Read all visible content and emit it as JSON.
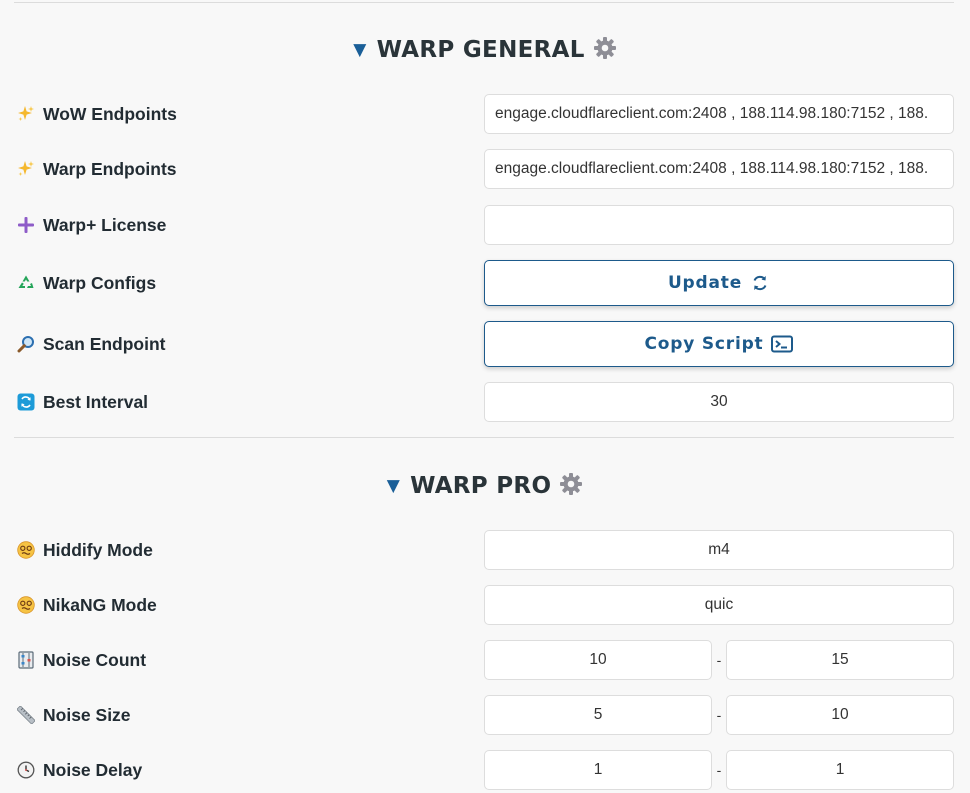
{
  "warp_general": {
    "title": "WARP GENERAL",
    "rows": {
      "wow_endpoints": {
        "label": "WoW Endpoints",
        "value": "engage.cloudflareclient.com:2408 , 188.114.98.180:7152 , 188."
      },
      "warp_endpoints": {
        "label": "Warp Endpoints",
        "value": "engage.cloudflareclient.com:2408 , 188.114.98.180:7152 , 188."
      },
      "warp_license": {
        "label": "Warp+ License",
        "value": ""
      },
      "warp_configs": {
        "label": "Warp Configs",
        "button": "Update"
      },
      "scan_endpoint": {
        "label": "Scan Endpoint",
        "button": "Copy Script"
      },
      "best_interval": {
        "label": "Best Interval",
        "value": "30"
      }
    }
  },
  "warp_pro": {
    "title": "WARP PRO",
    "rows": {
      "hiddify_mode": {
        "label": "Hiddify Mode",
        "value": "m4"
      },
      "nikang_mode": {
        "label": "NikaNG Mode",
        "value": "quic"
      },
      "noise_count": {
        "label": "Noise Count",
        "min": "10",
        "separator": "-",
        "max": "15"
      },
      "noise_size": {
        "label": "Noise Size",
        "min": "5",
        "separator": "-",
        "max": "10"
      },
      "noise_delay": {
        "label": "Noise Delay",
        "min": "1",
        "separator": "-",
        "max": "1"
      }
    }
  },
  "icons": {
    "section_marker": "triangle-down-icon",
    "section_settings": "gear-icon",
    "wow_endpoints": "sparkles-icon",
    "warp_endpoints": "sparkles-icon",
    "warp_license": "plus-icon",
    "warp_configs": "recycle-icon",
    "scan_endpoint": "magnifier-icon",
    "best_interval": "refresh-icon",
    "hiddify_mode": "dizzy-face-icon",
    "nikang_mode": "dizzy-face-icon",
    "noise_count": "abacus-icon",
    "noise_size": "ruler-icon",
    "noise_delay": "clock-icon",
    "update_button": "refresh-arrows-icon",
    "copy_script_button": "terminal-icon"
  },
  "colors": {
    "accent": "#1d5a8b",
    "background": "#f8f8f8",
    "field_border": "#dddddd",
    "divider": "#dcdcdc"
  }
}
